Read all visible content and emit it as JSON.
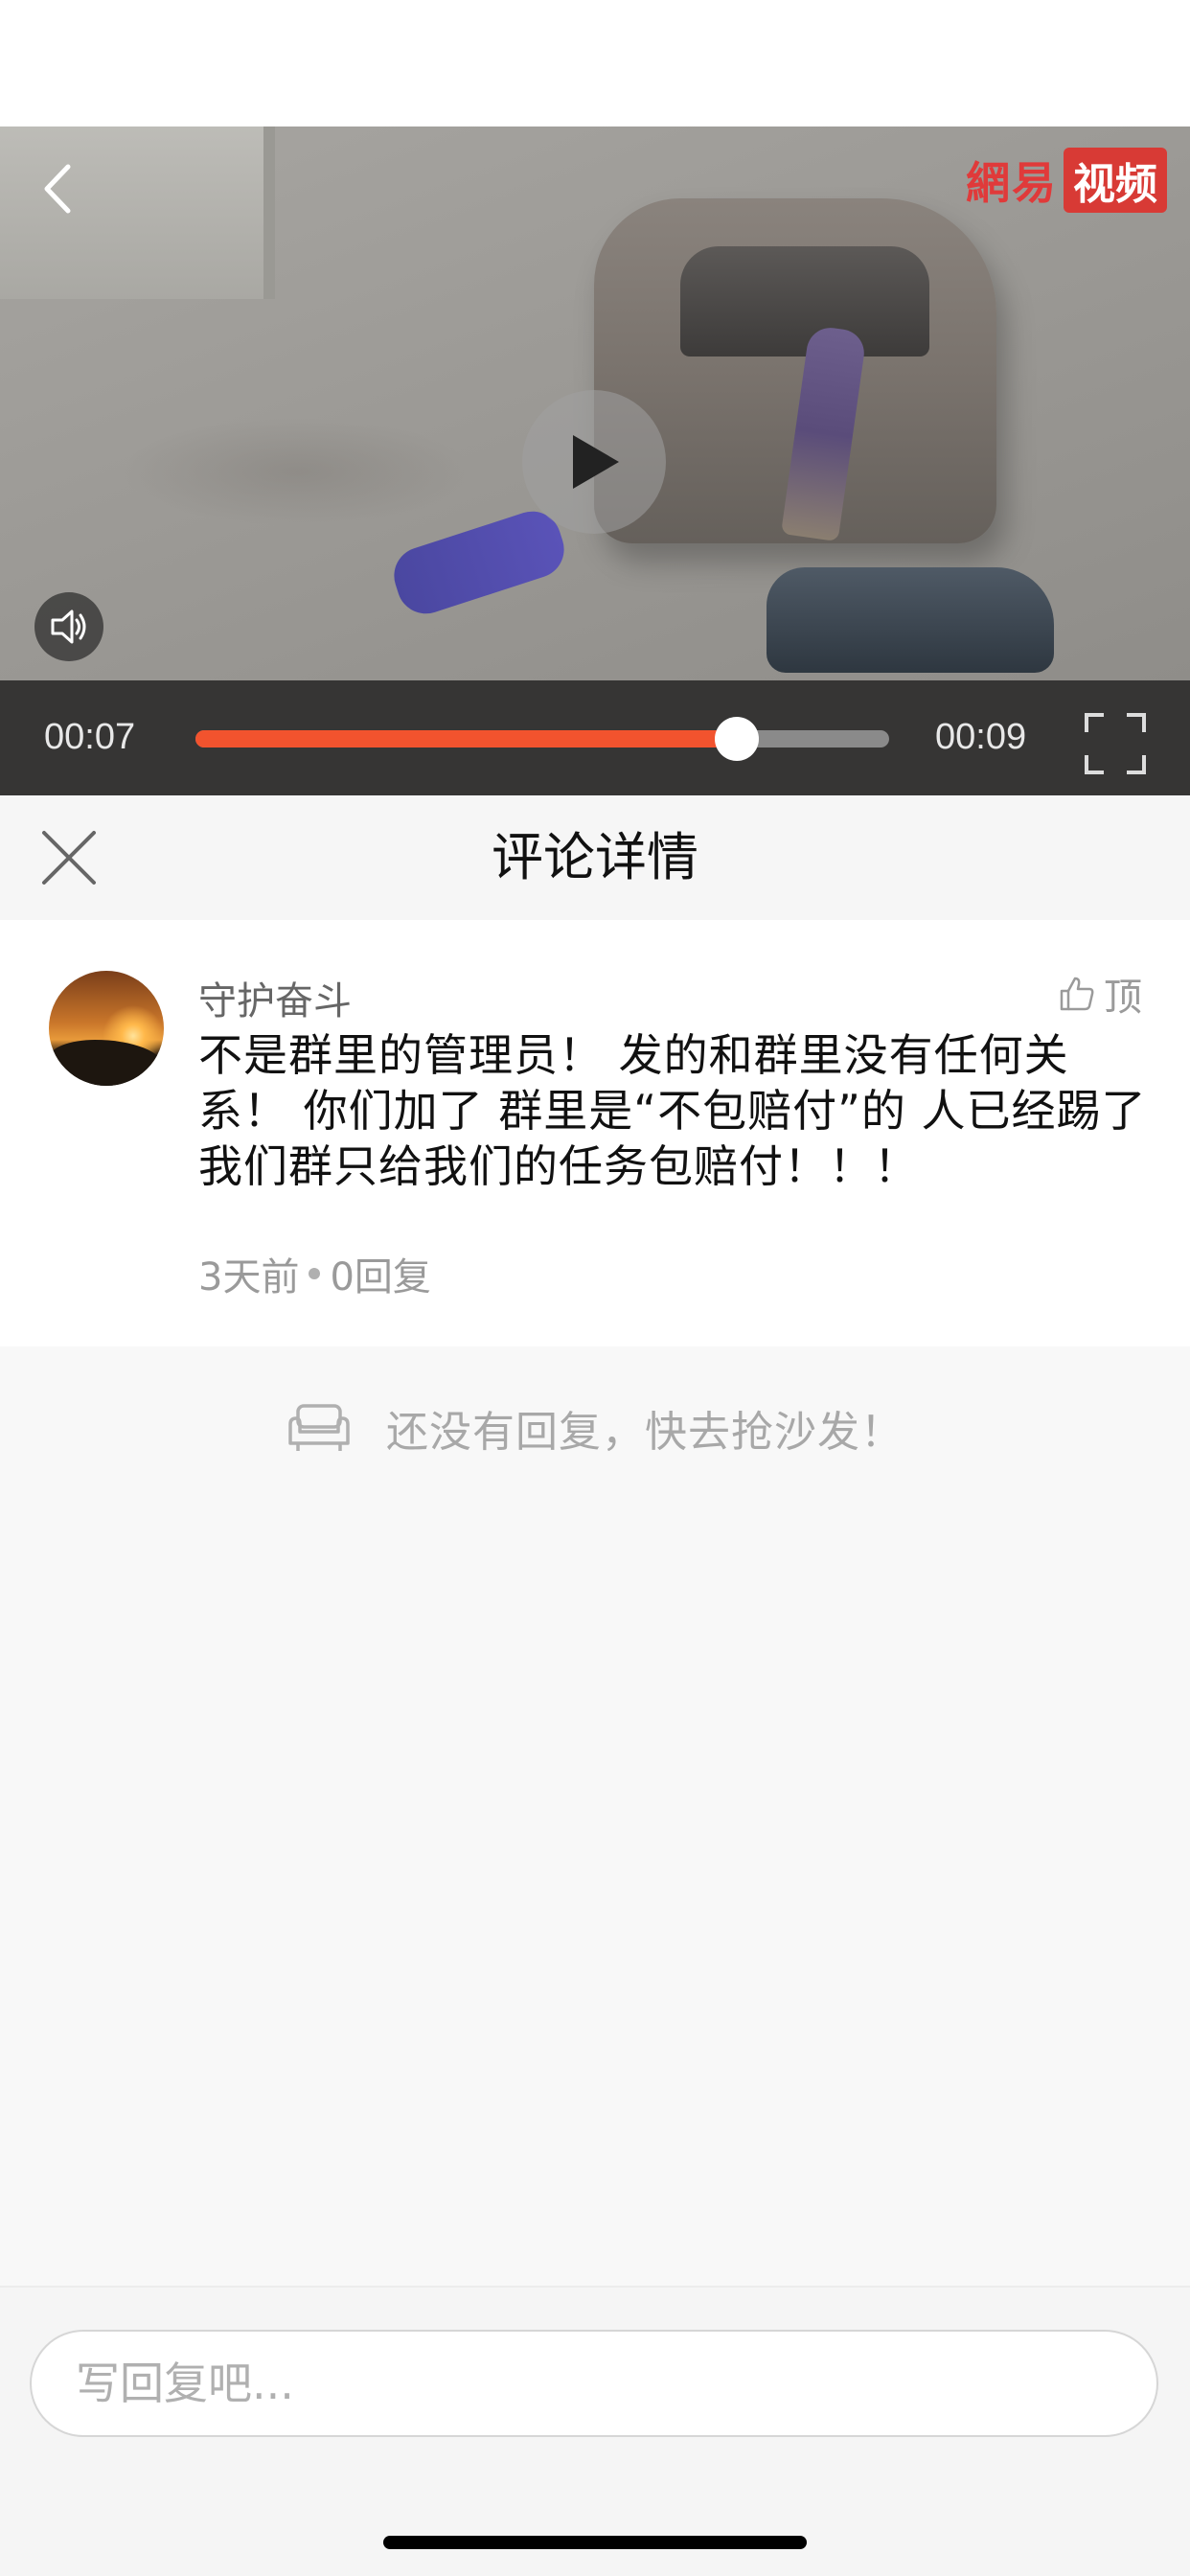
{
  "video": {
    "logo_text": "網易",
    "logo_box_text": "视频",
    "current_time": "00:07",
    "total_time": "00:09",
    "progress_fraction": 0.78,
    "accent_color": "#f2532e",
    "icons": {
      "back": "chevron-left-icon",
      "play": "play-icon",
      "volume": "volume-icon",
      "fullscreen": "fullscreen-icon"
    }
  },
  "header": {
    "title": "评论详情",
    "close_icon": "close-icon"
  },
  "comment": {
    "username": "守护奋斗",
    "like_label": "顶",
    "body": "不是群里的管理员！ 发的和群里没有任何关系！ 你们加了 群里是“不包赔付”的 人已经踢了  我们群只给我们的任务包赔付！！！",
    "time_ago": "3天前",
    "reply_count": "0回复"
  },
  "empty_state": {
    "text": "还没有回复，快去抢沙发！",
    "icon": "sofa-icon"
  },
  "footer": {
    "reply_placeholder": "写回复吧..."
  }
}
